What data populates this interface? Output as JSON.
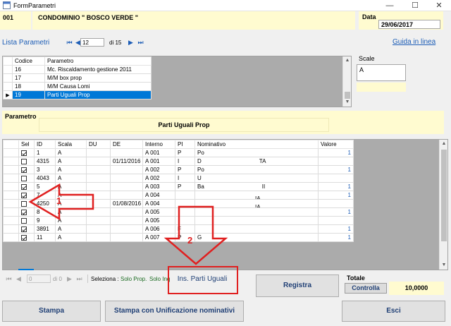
{
  "window": {
    "title": "FormParametri",
    "minimize": "—",
    "maximize": "☐",
    "close": "✕"
  },
  "header": {
    "code": "001",
    "condominio": "CONDOMINIO \" BOSCO VERDE \"",
    "data_label": "Data",
    "data_value": "29/06/2017"
  },
  "lista": {
    "label": "Lista Parametri",
    "first": "⏮",
    "prev": "◀",
    "position": "12",
    "of": "di 15",
    "next": "▶",
    "last": "⏭",
    "guida": "Guida in linea",
    "columns": [
      "Codice",
      "Parametro"
    ],
    "rows": [
      {
        "codice": "16",
        "parametro": "Mc. Riscaldamento gestione 2011"
      },
      {
        "codice": "17",
        "parametro": "M/M box prop"
      },
      {
        "codice": "18",
        "parametro": "M/M Causa Lomi"
      },
      {
        "codice": "19",
        "parametro": "Parti Uguali Prop"
      }
    ],
    "current_marker": "▶"
  },
  "scale": {
    "label": "Scale",
    "value": "A"
  },
  "parametro": {
    "label": "Parametro",
    "value": "Parti Uguali Prop"
  },
  "detail": {
    "columns": [
      "Sel",
      "ID",
      "Scala",
      "DU",
      "DE",
      "Interno",
      "PI",
      "Nominativo",
      "Valore"
    ],
    "rows": [
      {
        "sel": true,
        "id": "1",
        "scala": "A",
        "du": "",
        "de": "",
        "interno": "A 001",
        "pi": "P",
        "nominativo": "Po",
        "valore": "1"
      },
      {
        "sel": false,
        "id": "4315",
        "scala": "A",
        "du": "",
        "de": "01/11/2016",
        "interno": "A 001",
        "pi": "I",
        "nominativo": "D",
        "nominativo_tail": "TA",
        "valore": ""
      },
      {
        "sel": true,
        "id": "3",
        "scala": "A",
        "du": "",
        "de": "",
        "interno": "A 002",
        "pi": "P",
        "nominativo": "Po",
        "valore": "1"
      },
      {
        "sel": false,
        "id": "4043",
        "scala": "A",
        "du": "",
        "de": "",
        "interno": "A 002",
        "pi": "I",
        "nominativo": "U",
        "valore": ""
      },
      {
        "sel": true,
        "id": "5",
        "scala": "A",
        "du": "",
        "de": "",
        "interno": "A 003",
        "pi": "P",
        "nominativo": "Ba",
        "nominativo_tail": "II",
        "valore": "1"
      },
      {
        "sel": true,
        "id": "7",
        "scala": "A",
        "du": "",
        "de": "",
        "interno": "A 004",
        "pi": "",
        "nominativo": "",
        "nominativo_tail": "IA",
        "valore": "1"
      },
      {
        "sel": false,
        "id": "4250",
        "scala": "A",
        "du": "",
        "de": "01/08/2016",
        "interno": "A 004",
        "pi": "",
        "nominativo": "",
        "nominativo_tail": "IA",
        "valore": ""
      },
      {
        "sel": true,
        "id": "8",
        "scala": "A",
        "du": "",
        "de": "",
        "interno": "A 005",
        "pi": "",
        "nominativo": "",
        "valore": "1"
      },
      {
        "sel": false,
        "id": "9",
        "scala": "A",
        "du": "",
        "de": "",
        "interno": "A 005",
        "pi": "",
        "nominativo": "",
        "valore": ""
      },
      {
        "sel": true,
        "id": "3891",
        "scala": "A",
        "du": "",
        "de": "",
        "interno": "A 006",
        "pi": "F",
        "nominativo": "",
        "valore": "1"
      },
      {
        "sel": true,
        "id": "11",
        "scala": "A",
        "du": "",
        "de": "",
        "interno": "A 007",
        "pi": "P",
        "nominativo": "G",
        "valore": "1"
      }
    ]
  },
  "bottom_nav": {
    "first": "⏮",
    "prev": "◀",
    "position": "0",
    "of": "di 0",
    "next": "▶",
    "last": "⏭"
  },
  "seleziona": {
    "label": "Seleziona :",
    "solo_prop": "Solo Prop.",
    "solo_inq": "Solo Inq"
  },
  "buttons": {
    "ins_parti_uguali": "Ins. Parti Uguali",
    "registra": "Registra",
    "controlla": "Controlla",
    "stampa": "Stampa",
    "stampa_unificazione": "Stampa con Unificazione nominativi",
    "esci": "Esci"
  },
  "totale": {
    "label": "Totale",
    "value": "10,0000"
  },
  "annotations": {
    "arrow1": "1",
    "arrow2": "2"
  },
  "colors": {
    "yellow": "#fffbd0",
    "selection": "#0078d7",
    "link": "#1c5db6",
    "annotation": "#e02020"
  }
}
